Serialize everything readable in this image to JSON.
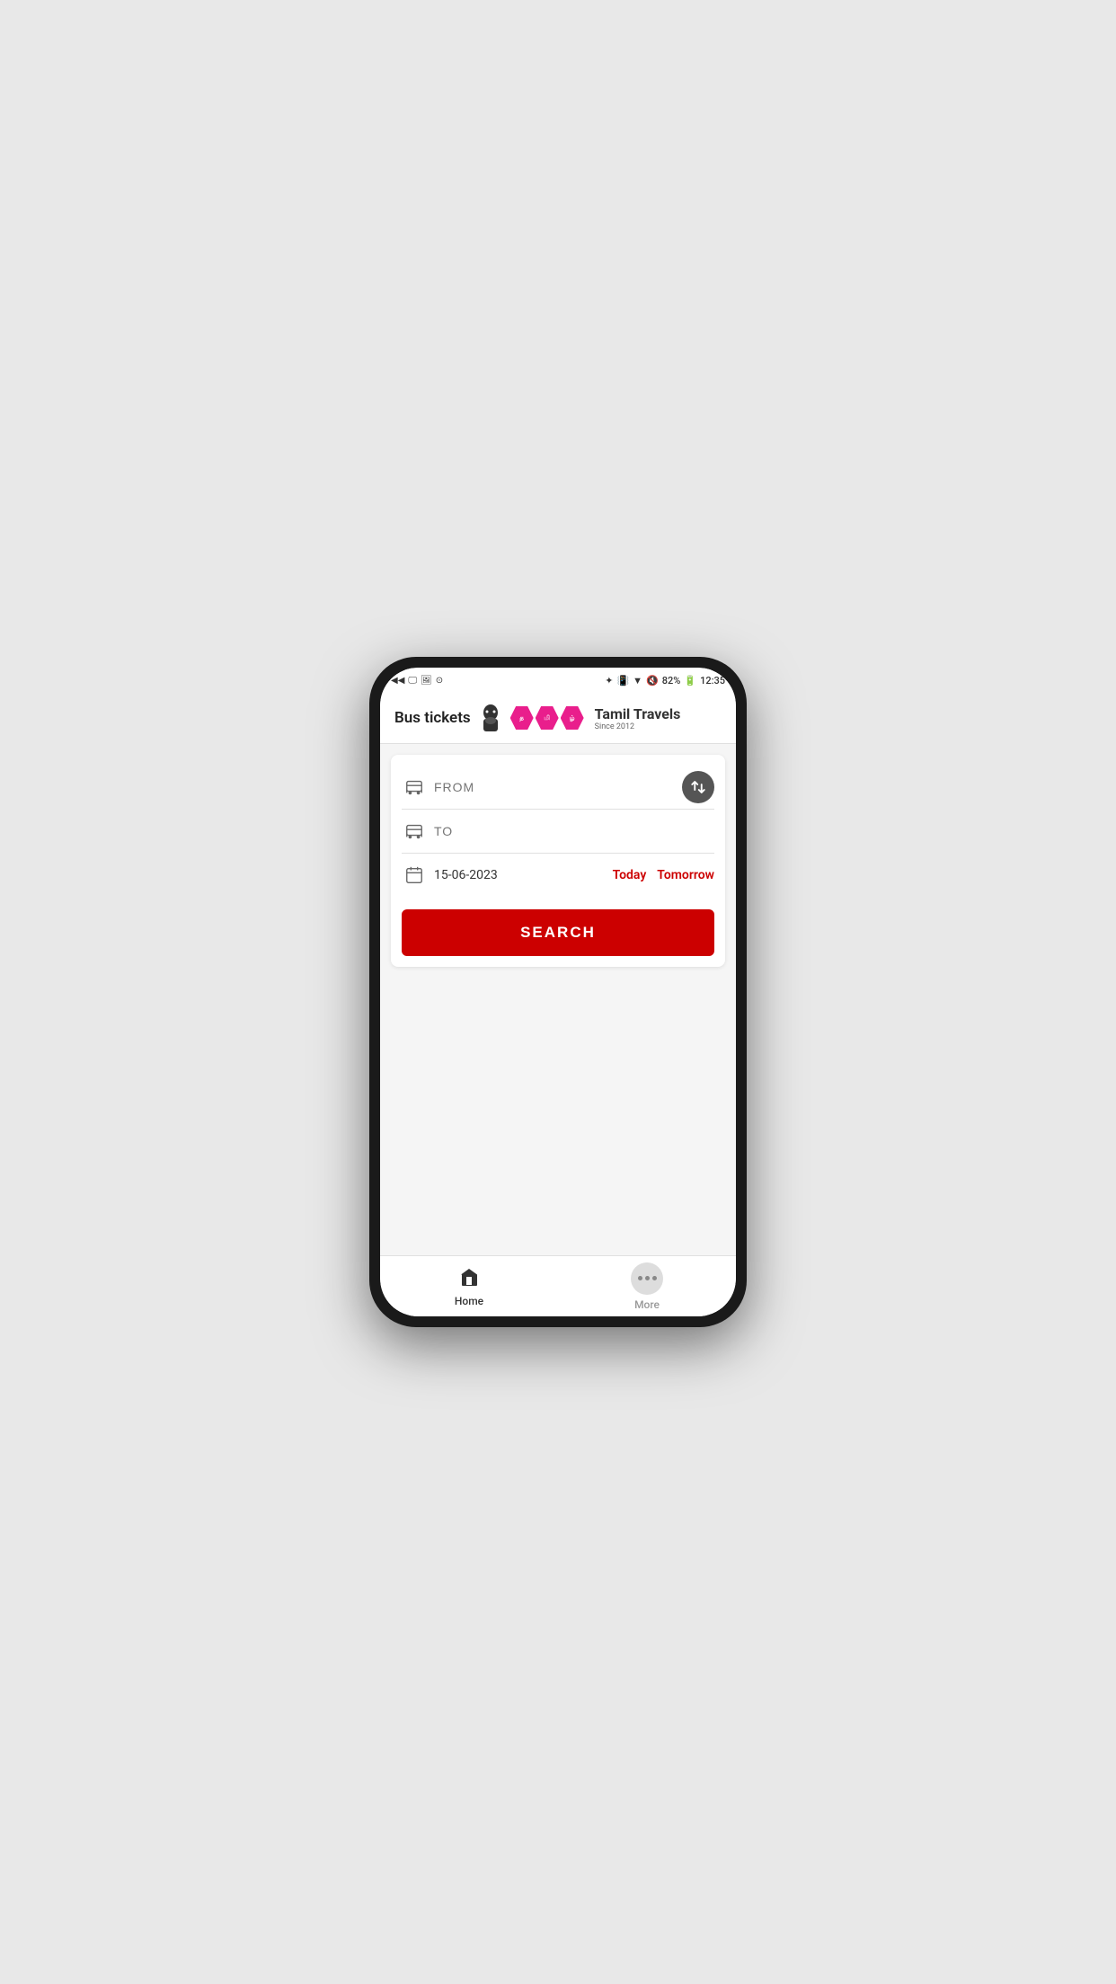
{
  "statusBar": {
    "battery": "82%",
    "time": "12:35",
    "icons": [
      "back1",
      "back2",
      "screen",
      "image",
      "circle",
      "bluetooth",
      "vibrate",
      "wifi",
      "mute"
    ]
  },
  "header": {
    "busTicketsLabel": "Bus tickets",
    "brandName": "Tamil Travels",
    "since": "Since 2012",
    "hexTexts": [
      "த",
      "மி",
      "ழ்"
    ]
  },
  "form": {
    "fromPlaceholder": "FROM",
    "toPlaceholder": "TO",
    "date": "15-06-2023",
    "todayLabel": "Today",
    "tomorrowLabel": "Tomorrow",
    "searchLabel": "SEARCH"
  },
  "bottomNav": {
    "homeLabel": "Home",
    "moreLabel": "More"
  }
}
